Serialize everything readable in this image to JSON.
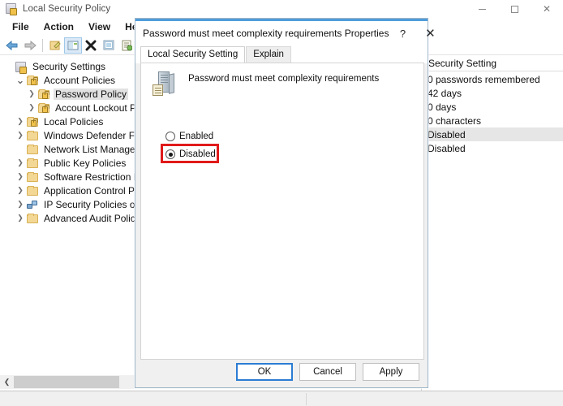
{
  "window": {
    "title": "Local Security Policy",
    "icon": "security-policy-icon",
    "controls": {
      "minimize": "–",
      "maximize": "□",
      "close": "✕"
    }
  },
  "menubar": {
    "items": [
      "File",
      "Action",
      "View",
      "Help"
    ]
  },
  "toolbar": {
    "buttons": [
      {
        "name": "back-button",
        "glyph": "⬅"
      },
      {
        "name": "forward-button",
        "glyph": "➡"
      },
      {
        "name": "show-hide-console-tree-button",
        "glyph": "✎"
      },
      {
        "name": "properties-button",
        "glyph": "▤",
        "selected": true
      },
      {
        "name": "delete-button",
        "glyph": "✖"
      },
      {
        "name": "export-list-button",
        "glyph": "⊞"
      },
      {
        "name": "help-button",
        "glyph": "☰"
      }
    ]
  },
  "tree": {
    "nodes": [
      {
        "label": "Security Settings",
        "indent": 0,
        "chevron": "",
        "icon": "shield-lock-icon",
        "selected": false
      },
      {
        "label": "Account Policies",
        "indent": 1,
        "chevron": "down",
        "icon": "folder-lock-icon",
        "selected": false
      },
      {
        "label": "Password Policy",
        "indent": 2,
        "chevron": "right",
        "icon": "folder-lock-icon",
        "selected": true
      },
      {
        "label": "Account Lockout Polic",
        "indent": 2,
        "chevron": "right",
        "icon": "folder-lock-icon",
        "selected": false
      },
      {
        "label": "Local Policies",
        "indent": 1,
        "chevron": "right",
        "icon": "folder-lock-icon",
        "selected": false
      },
      {
        "label": "Windows Defender Firewal",
        "indent": 1,
        "chevron": "right",
        "icon": "folder-icon",
        "selected": false
      },
      {
        "label": "Network List Manager Poli",
        "indent": 1,
        "chevron": "",
        "icon": "folder-icon",
        "selected": false
      },
      {
        "label": "Public Key Policies",
        "indent": 1,
        "chevron": "right",
        "icon": "folder-icon",
        "selected": false
      },
      {
        "label": "Software Restriction Polici",
        "indent": 1,
        "chevron": "right",
        "icon": "folder-icon",
        "selected": false
      },
      {
        "label": "Application Control Policie",
        "indent": 1,
        "chevron": "right",
        "icon": "folder-icon",
        "selected": false
      },
      {
        "label": "IP Security Policies on Loc",
        "indent": 1,
        "chevron": "right",
        "icon": "network-policy-icon",
        "selected": false
      },
      {
        "label": "Advanced Audit Policy Co",
        "indent": 1,
        "chevron": "right",
        "icon": "folder-icon",
        "selected": false
      }
    ]
  },
  "list": {
    "column_header": "Security Setting",
    "rows": [
      {
        "value": "0 passwords remembered",
        "selected": false
      },
      {
        "value": "42 days",
        "selected": false
      },
      {
        "value": "0 days",
        "selected": false
      },
      {
        "value": "0 characters",
        "selected": false
      },
      {
        "value": "Disabled",
        "selected": true
      },
      {
        "value": "Disabled",
        "selected": false
      }
    ]
  },
  "scrollbar": {
    "left_arrow": "❮"
  },
  "dialog": {
    "title": "Password must meet complexity requirements Properties",
    "help_glyph": "?",
    "close_glyph": "✕",
    "tabs": [
      {
        "label": "Local Security Setting",
        "active": true
      },
      {
        "label": "Explain",
        "active": false
      }
    ],
    "policy_name": "Password must meet complexity requirements",
    "policy_icon": "computer-policy-icon",
    "options": [
      {
        "label": "Enabled",
        "checked": false,
        "highlighted": false
      },
      {
        "label": "Disabled",
        "checked": true,
        "highlighted": true
      }
    ],
    "highlight_color": "#e01b1b",
    "buttons": [
      {
        "label": "OK",
        "name": "ok-button",
        "default": true
      },
      {
        "label": "Cancel",
        "name": "cancel-button",
        "default": false
      },
      {
        "label": "Apply",
        "name": "apply-button",
        "default": false
      }
    ]
  }
}
